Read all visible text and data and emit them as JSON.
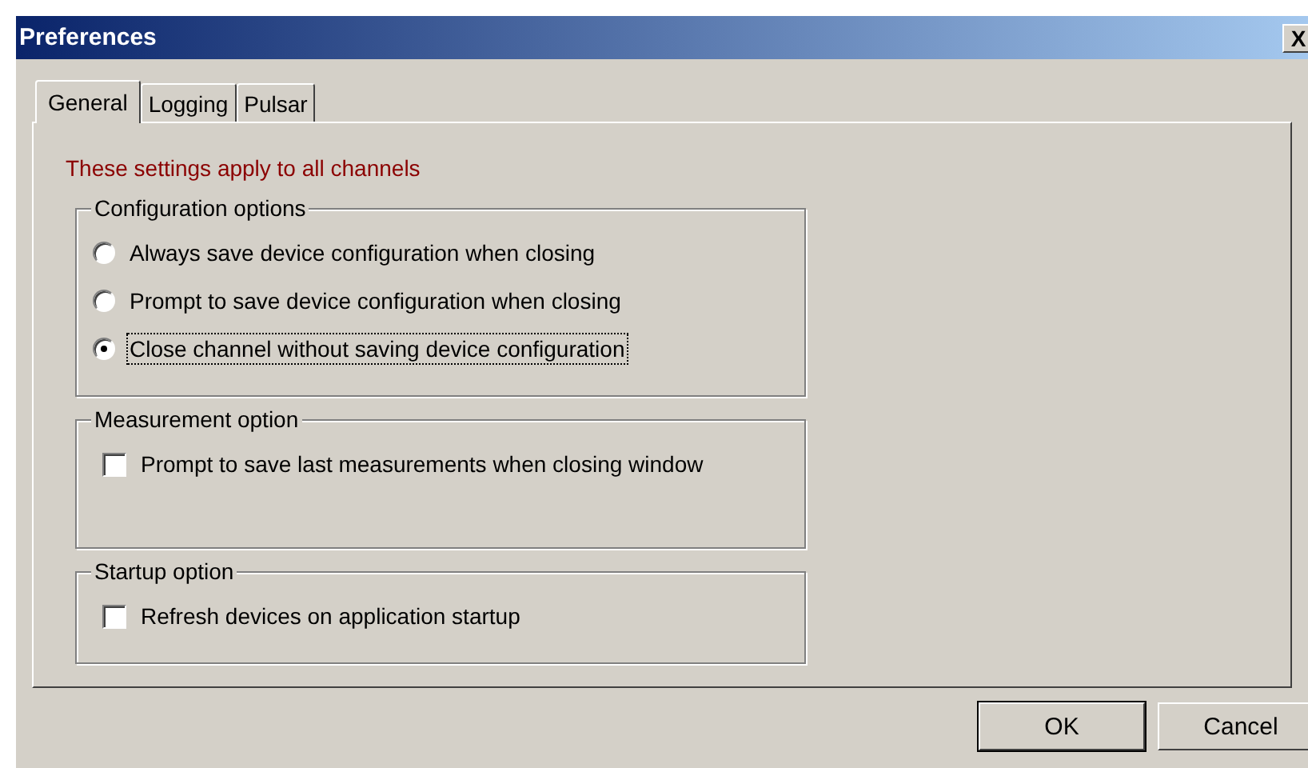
{
  "window": {
    "title": "Preferences",
    "close": "X"
  },
  "tabs": [
    {
      "label": "General",
      "selected": true
    },
    {
      "label": "Logging",
      "selected": false
    },
    {
      "label": "Pulsar",
      "selected": false
    }
  ],
  "note": "These settings apply to all channels",
  "groups": [
    {
      "title": "Configuration options",
      "items": [
        {
          "kind": "radio",
          "label": "Always save device configuration when closing",
          "checked": false,
          "focused": false
        },
        {
          "kind": "radio",
          "label": "Prompt to save device configuration when closing",
          "checked": false,
          "focused": false
        },
        {
          "kind": "radio",
          "label": "Close channel without saving device configuration",
          "checked": true,
          "focused": true
        }
      ]
    },
    {
      "title": "Measurement option",
      "items": [
        {
          "kind": "checkbox",
          "label": "Prompt to save last measurements when closing window",
          "checked": false,
          "focused": false
        }
      ]
    },
    {
      "title": "Startup option",
      "items": [
        {
          "kind": "checkbox",
          "label": "Refresh devices on application startup",
          "checked": false,
          "focused": false
        }
      ]
    }
  ],
  "buttons": [
    {
      "label": "OK",
      "default": true
    },
    {
      "label": "Cancel",
      "default": false
    }
  ]
}
